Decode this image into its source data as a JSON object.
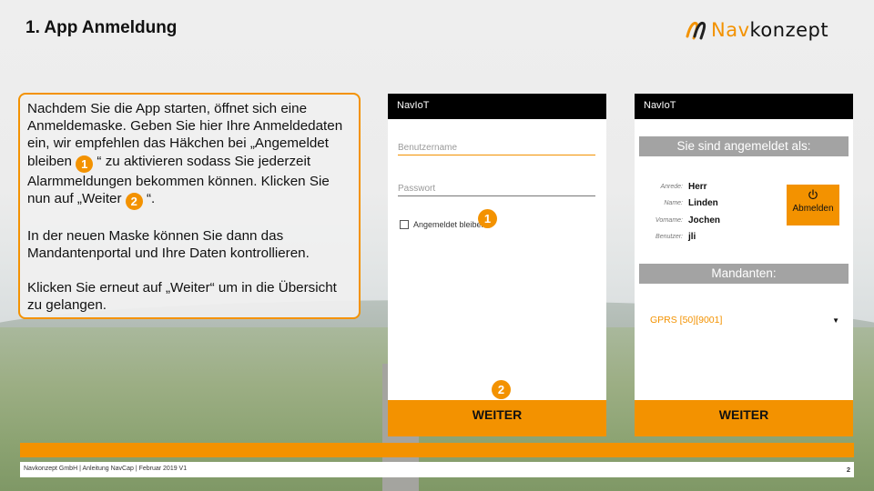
{
  "slide": {
    "title": "1. App Anmeldung",
    "page_number": "2"
  },
  "logo": {
    "part1": "Nav",
    "part2": "konzept",
    "accent_color": "#f39200"
  },
  "instructions": {
    "p1_a": "Nachdem Sie die App starten, öffnet sich eine Anmeldemaske. Geben Sie hier Ihre Anmeldedaten ein, wir empfehlen das Häkchen bei „Angemeldet bleiben ",
    "badge1": "1",
    "p1_b": " “ zu aktivieren sodass Sie jederzeit Alarmmeldungen bekommen können. Klicken Sie nun auf „Weiter ",
    "badge2": "2",
    "p1_c": " “.",
    "p2": "In der neuen Maske können Sie dann das Mandantenportal und Ihre Daten kontrollieren.",
    "p3": "Klicken Sie erneut auf „Weiter“ um in die Übersicht zu gelangen."
  },
  "login_screen": {
    "app_title": "NavIoT",
    "username_placeholder": "Benutzername",
    "password_placeholder": "Passwort",
    "remember_label": "Angemeldet bleiben",
    "badge1": "1",
    "badge2": "2",
    "button_label": "WEITER"
  },
  "account_screen": {
    "app_title": "NavIoT",
    "logged_in_header": "Sie sind angemeldet als:",
    "fields": [
      {
        "label": "Anrede:",
        "value": "Herr"
      },
      {
        "label": "Name:",
        "value": "Linden"
      },
      {
        "label": "Vorname:",
        "value": "Jochen"
      },
      {
        "label": "Benutzer:",
        "value": "jli"
      }
    ],
    "logout_label": "Abmelden",
    "mandanten_header": "Mandanten:",
    "mandant_selected": "GPRS [50][9001]",
    "button_label": "WEITER"
  },
  "footer": {
    "text": "Navkonzept GmbH  |  Anleitung NavCap  | Februar 2019 V1"
  }
}
